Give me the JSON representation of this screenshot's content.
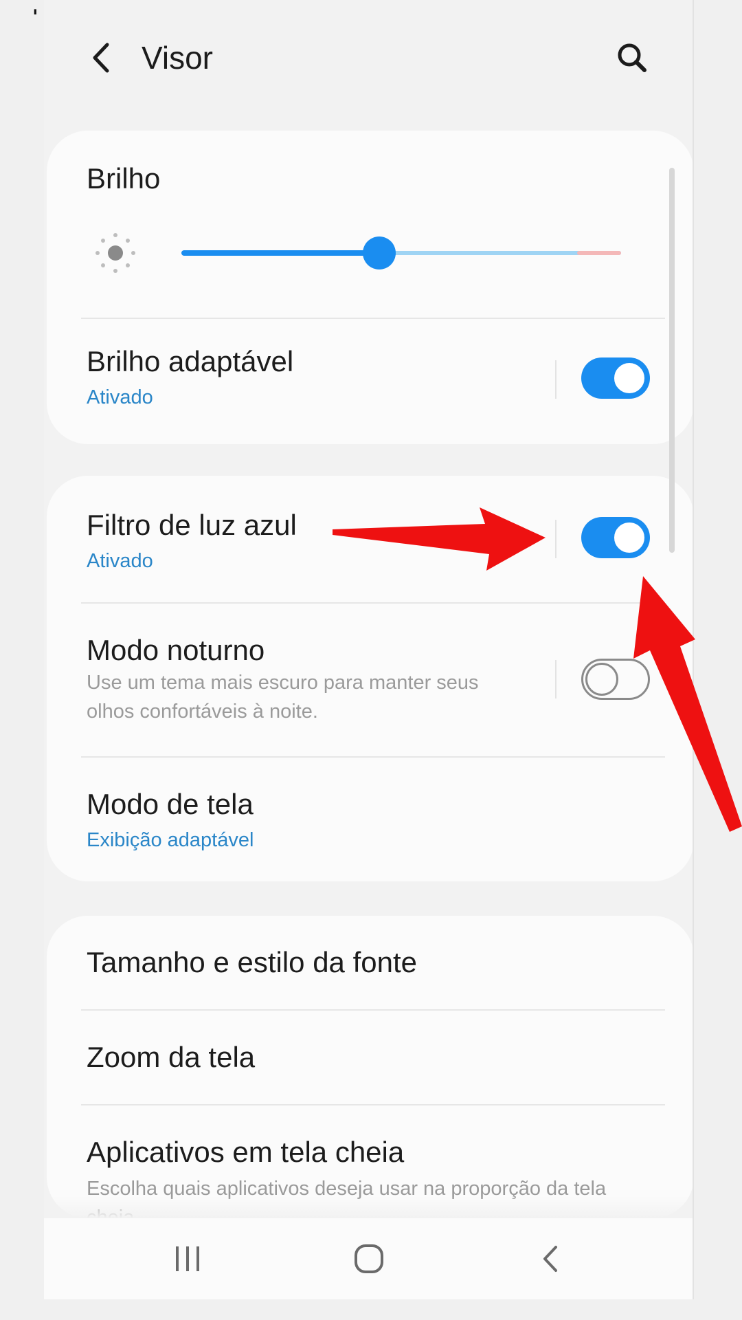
{
  "header": {
    "title": "Visor",
    "back_icon": "chevron-left-icon",
    "search_icon": "search-icon"
  },
  "brightness": {
    "label": "Brilho",
    "level_percent": 45,
    "icon": "sun-icon"
  },
  "adaptive_brightness": {
    "label": "Brilho adaptável",
    "status": "Ativado",
    "enabled": true
  },
  "blue_light_filter": {
    "label": "Filtro de luz azul",
    "status": "Ativado",
    "enabled": true
  },
  "night_mode": {
    "label": "Modo noturno",
    "description": "Use um tema mais escuro para manter seus olhos confortáveis à noite.",
    "enabled": false
  },
  "screen_mode": {
    "label": "Modo de tela",
    "value": "Exibição adaptável"
  },
  "font": {
    "label": "Tamanho e estilo da fonte"
  },
  "screen_zoom": {
    "label": "Zoom da tela"
  },
  "fullscreen_apps": {
    "label": "Aplicativos em tela cheia",
    "description": "Escolha quais aplicativos deseja usar na proporção da tela cheia"
  },
  "navbar": {
    "recents_icon": "recents-icon",
    "home_icon": "home-icon",
    "back_icon": "back-icon"
  },
  "colors": {
    "accent": "#1a8df0",
    "status_text": "#2a86c8",
    "annotation_arrow": "#ee1111"
  }
}
